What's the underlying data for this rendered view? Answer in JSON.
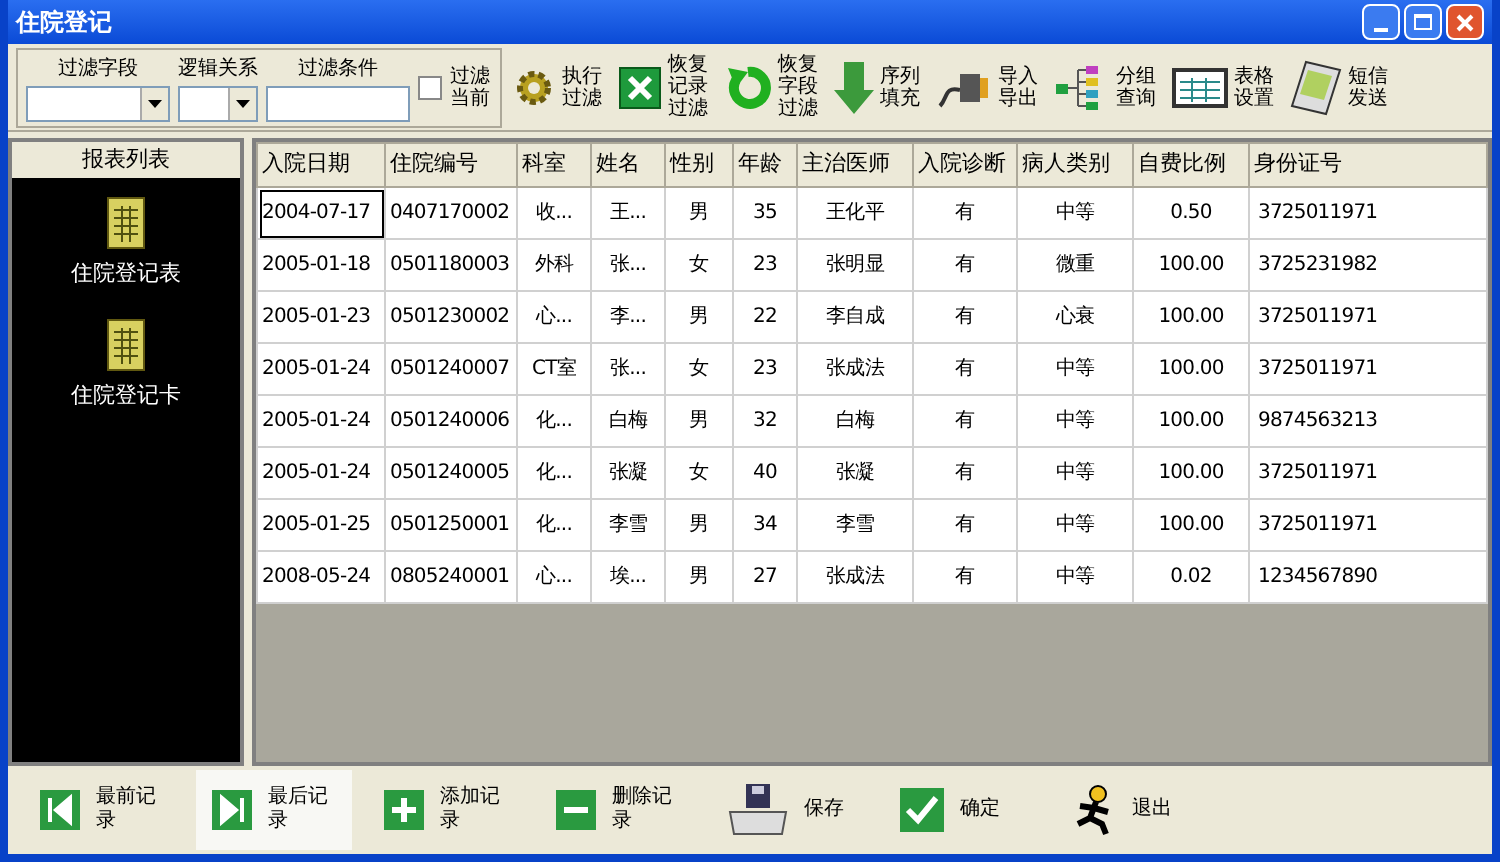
{
  "window": {
    "title": "住院登记"
  },
  "filter": {
    "fields": [
      {
        "label": "过滤字段",
        "kind": "combo"
      },
      {
        "label": "逻辑关系",
        "kind": "combo"
      },
      {
        "label": "过滤条件",
        "kind": "text"
      }
    ],
    "current": {
      "label": "过滤当前",
      "checked": false
    }
  },
  "toolbar": [
    {
      "label": "执行过滤",
      "kind": "gear"
    },
    {
      "label": "恢复记录过滤",
      "kind": "cross"
    },
    {
      "label": "恢复字段过滤",
      "kind": "undo"
    },
    {
      "label": "序列填充",
      "kind": "down"
    },
    {
      "label": "导入导出",
      "kind": "plug"
    },
    {
      "label": "分组查询",
      "kind": "tree"
    },
    {
      "label": "表格设置",
      "kind": "table"
    },
    {
      "label": "短信发送",
      "kind": "pda"
    }
  ],
  "sidebar": {
    "title": "报表列表",
    "items": [
      {
        "label": "住院登记表"
      },
      {
        "label": "住院登记卡"
      }
    ]
  },
  "table": {
    "columns": [
      "入院日期",
      "住院编号",
      "科室",
      "姓名",
      "性别",
      "年龄",
      "主治医师",
      "入院诊断",
      "病人类别",
      "自费比例",
      "身份证号"
    ],
    "rows": [
      {
        "focused": true,
        "cells": [
          "2004-07-17",
          "0407170002",
          "收...",
          "王...",
          "男",
          "35",
          "王化平",
          "有",
          "中等",
          "0.50",
          "3725011971"
        ]
      },
      {
        "focused": false,
        "cells": [
          "2005-01-18",
          "0501180003",
          "外科",
          "张...",
          "女",
          "23",
          "张明显",
          "有",
          "微重",
          "100.00",
          "3725231982"
        ]
      },
      {
        "focused": false,
        "cells": [
          "2005-01-23",
          "0501230002",
          "心...",
          "李...",
          "男",
          "22",
          "李自成",
          "有",
          "心衰",
          "100.00",
          "3725011971"
        ]
      },
      {
        "focused": false,
        "cells": [
          "2005-01-24",
          "0501240007",
          "CT室",
          "张...",
          "女",
          "23",
          "张成法",
          "有",
          "中等",
          "100.00",
          "3725011971"
        ]
      },
      {
        "focused": false,
        "cells": [
          "2005-01-24",
          "0501240006",
          "化...",
          "白梅",
          "男",
          "32",
          "白梅",
          "有",
          "中等",
          "100.00",
          "9874563213"
        ]
      },
      {
        "focused": false,
        "cells": [
          "2005-01-24",
          "0501240005",
          "化...",
          "张凝",
          "女",
          "40",
          "张凝",
          "有",
          "中等",
          "100.00",
          "3725011971"
        ]
      },
      {
        "focused": false,
        "cells": [
          "2005-01-25",
          "0501250001",
          "化...",
          "李雪",
          "男",
          "34",
          "李雪",
          "有",
          "中等",
          "100.00",
          "3725011971"
        ]
      },
      {
        "focused": false,
        "cells": [
          "2008-05-24",
          "0805240001",
          "心...",
          "埃...",
          "男",
          "27",
          "张成法",
          "有",
          "中等",
          "0.02",
          "1234567890"
        ]
      }
    ]
  },
  "bottom_buttons": [
    {
      "label": "最前记录",
      "kind": "first",
      "pressed": false
    },
    {
      "label": "最后记录",
      "kind": "last",
      "pressed": true
    },
    {
      "label": "添加记录",
      "kind": "add",
      "pressed": false
    },
    {
      "label": "删除记录",
      "kind": "remove",
      "pressed": false
    },
    {
      "label": "保存",
      "kind": "save",
      "pressed": false
    },
    {
      "label": "确定",
      "kind": "ok",
      "pressed": false
    },
    {
      "label": "退出",
      "kind": "exit",
      "pressed": false
    }
  ]
}
